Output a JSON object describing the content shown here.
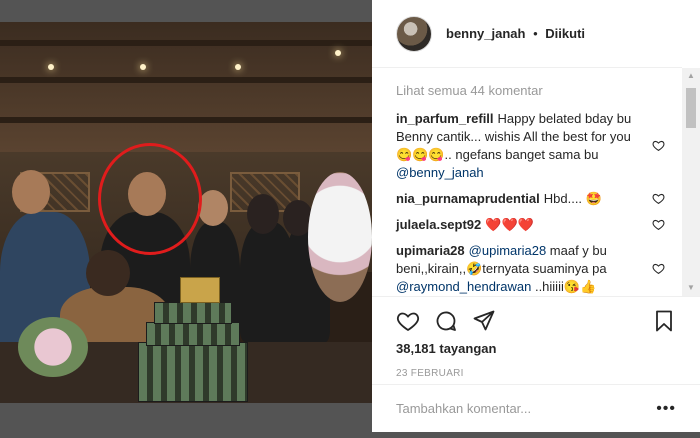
{
  "post": {
    "username": "benny_janah",
    "separator": "•",
    "follow_status": "Diikuti"
  },
  "comments": {
    "view_all": "Lihat semua 44 komentar",
    "items": [
      {
        "user": "in_parfum_refill",
        "text_a": "Happy belated bday bu Benny cantik... wishis All the best for you😋😋😋.. ngefans banget sama bu ",
        "mention": "@benny_janah",
        "text_b": ""
      },
      {
        "user": "nia_purnamaprudential",
        "text_a": "Hbd.... 🤩",
        "mention": "",
        "text_b": ""
      },
      {
        "user": "julaela.sept92",
        "text_a": "❤️❤️❤️",
        "mention": "",
        "text_b": ""
      },
      {
        "user": "upimaria28",
        "text_a": "",
        "mention": "@upimaria28",
        "text_b": " maaf y bu beni,,kirain,,🤣ternyata suaminya pa ",
        "mention2": "@raymond_hendrawan",
        "text_c": " ..hiiiii😘👍"
      }
    ]
  },
  "stats": {
    "views": "38,181 tayangan",
    "date": "23 FEBRUARI"
  },
  "add_comment": {
    "placeholder": "Tambahkan komentar...",
    "more": "•••"
  },
  "icons": [
    "heart-icon",
    "comment-icon",
    "share-icon",
    "bookmark-icon",
    "more-icon"
  ],
  "colors": {
    "highlight_circle": "#e01c1c",
    "mention": "#003569",
    "muted": "#999999"
  }
}
